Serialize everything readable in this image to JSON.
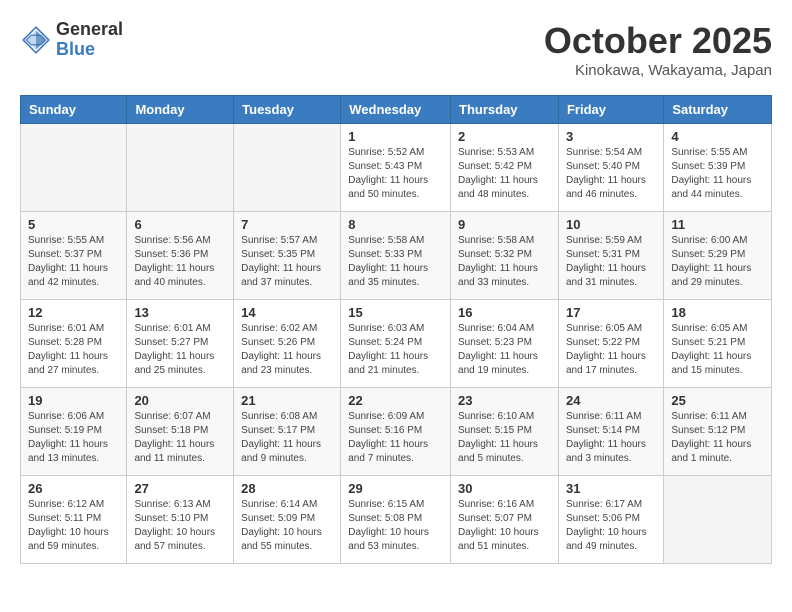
{
  "header": {
    "logo_general": "General",
    "logo_blue": "Blue",
    "month_title": "October 2025",
    "location": "Kinokawa, Wakayama, Japan"
  },
  "weekdays": [
    "Sunday",
    "Monday",
    "Tuesday",
    "Wednesday",
    "Thursday",
    "Friday",
    "Saturday"
  ],
  "weeks": [
    [
      {
        "day": "",
        "info": ""
      },
      {
        "day": "",
        "info": ""
      },
      {
        "day": "",
        "info": ""
      },
      {
        "day": "1",
        "info": "Sunrise: 5:52 AM\nSunset: 5:43 PM\nDaylight: 11 hours\nand 50 minutes."
      },
      {
        "day": "2",
        "info": "Sunrise: 5:53 AM\nSunset: 5:42 PM\nDaylight: 11 hours\nand 48 minutes."
      },
      {
        "day": "3",
        "info": "Sunrise: 5:54 AM\nSunset: 5:40 PM\nDaylight: 11 hours\nand 46 minutes."
      },
      {
        "day": "4",
        "info": "Sunrise: 5:55 AM\nSunset: 5:39 PM\nDaylight: 11 hours\nand 44 minutes."
      }
    ],
    [
      {
        "day": "5",
        "info": "Sunrise: 5:55 AM\nSunset: 5:37 PM\nDaylight: 11 hours\nand 42 minutes."
      },
      {
        "day": "6",
        "info": "Sunrise: 5:56 AM\nSunset: 5:36 PM\nDaylight: 11 hours\nand 40 minutes."
      },
      {
        "day": "7",
        "info": "Sunrise: 5:57 AM\nSunset: 5:35 PM\nDaylight: 11 hours\nand 37 minutes."
      },
      {
        "day": "8",
        "info": "Sunrise: 5:58 AM\nSunset: 5:33 PM\nDaylight: 11 hours\nand 35 minutes."
      },
      {
        "day": "9",
        "info": "Sunrise: 5:58 AM\nSunset: 5:32 PM\nDaylight: 11 hours\nand 33 minutes."
      },
      {
        "day": "10",
        "info": "Sunrise: 5:59 AM\nSunset: 5:31 PM\nDaylight: 11 hours\nand 31 minutes."
      },
      {
        "day": "11",
        "info": "Sunrise: 6:00 AM\nSunset: 5:29 PM\nDaylight: 11 hours\nand 29 minutes."
      }
    ],
    [
      {
        "day": "12",
        "info": "Sunrise: 6:01 AM\nSunset: 5:28 PM\nDaylight: 11 hours\nand 27 minutes."
      },
      {
        "day": "13",
        "info": "Sunrise: 6:01 AM\nSunset: 5:27 PM\nDaylight: 11 hours\nand 25 minutes."
      },
      {
        "day": "14",
        "info": "Sunrise: 6:02 AM\nSunset: 5:26 PM\nDaylight: 11 hours\nand 23 minutes."
      },
      {
        "day": "15",
        "info": "Sunrise: 6:03 AM\nSunset: 5:24 PM\nDaylight: 11 hours\nand 21 minutes."
      },
      {
        "day": "16",
        "info": "Sunrise: 6:04 AM\nSunset: 5:23 PM\nDaylight: 11 hours\nand 19 minutes."
      },
      {
        "day": "17",
        "info": "Sunrise: 6:05 AM\nSunset: 5:22 PM\nDaylight: 11 hours\nand 17 minutes."
      },
      {
        "day": "18",
        "info": "Sunrise: 6:05 AM\nSunset: 5:21 PM\nDaylight: 11 hours\nand 15 minutes."
      }
    ],
    [
      {
        "day": "19",
        "info": "Sunrise: 6:06 AM\nSunset: 5:19 PM\nDaylight: 11 hours\nand 13 minutes."
      },
      {
        "day": "20",
        "info": "Sunrise: 6:07 AM\nSunset: 5:18 PM\nDaylight: 11 hours\nand 11 minutes."
      },
      {
        "day": "21",
        "info": "Sunrise: 6:08 AM\nSunset: 5:17 PM\nDaylight: 11 hours\nand 9 minutes."
      },
      {
        "day": "22",
        "info": "Sunrise: 6:09 AM\nSunset: 5:16 PM\nDaylight: 11 hours\nand 7 minutes."
      },
      {
        "day": "23",
        "info": "Sunrise: 6:10 AM\nSunset: 5:15 PM\nDaylight: 11 hours\nand 5 minutes."
      },
      {
        "day": "24",
        "info": "Sunrise: 6:11 AM\nSunset: 5:14 PM\nDaylight: 11 hours\nand 3 minutes."
      },
      {
        "day": "25",
        "info": "Sunrise: 6:11 AM\nSunset: 5:12 PM\nDaylight: 11 hours\nand 1 minute."
      }
    ],
    [
      {
        "day": "26",
        "info": "Sunrise: 6:12 AM\nSunset: 5:11 PM\nDaylight: 10 hours\nand 59 minutes."
      },
      {
        "day": "27",
        "info": "Sunrise: 6:13 AM\nSunset: 5:10 PM\nDaylight: 10 hours\nand 57 minutes."
      },
      {
        "day": "28",
        "info": "Sunrise: 6:14 AM\nSunset: 5:09 PM\nDaylight: 10 hours\nand 55 minutes."
      },
      {
        "day": "29",
        "info": "Sunrise: 6:15 AM\nSunset: 5:08 PM\nDaylight: 10 hours\nand 53 minutes."
      },
      {
        "day": "30",
        "info": "Sunrise: 6:16 AM\nSunset: 5:07 PM\nDaylight: 10 hours\nand 51 minutes."
      },
      {
        "day": "31",
        "info": "Sunrise: 6:17 AM\nSunset: 5:06 PM\nDaylight: 10 hours\nand 49 minutes."
      },
      {
        "day": "",
        "info": ""
      }
    ]
  ]
}
